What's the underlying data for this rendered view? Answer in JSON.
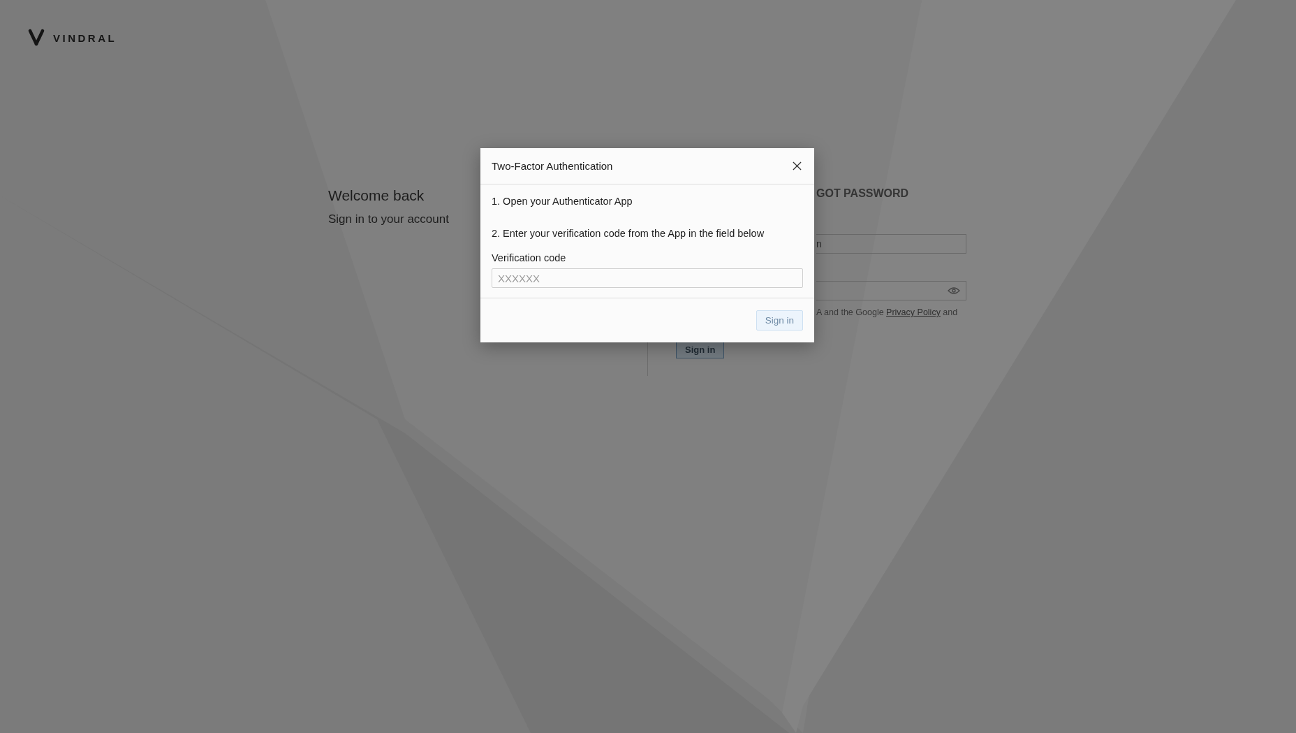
{
  "logo": {
    "wordmark": "VINDRAL"
  },
  "welcome": {
    "title": "Welcome back",
    "subtitle": "Sign in to your account"
  },
  "login_form": {
    "tab_fragment": "GOT PASSWORD",
    "username_fragment": "n",
    "legal": {
      "before": "A and the Google",
      "link": "Privacy Policy",
      "after": "and"
    },
    "submit": {
      "label": "Sign in"
    }
  },
  "dialog": {
    "title": "Two-Factor Authentication",
    "steps": [
      "1. Open your Authenticator App",
      "2. Enter your verification code from the App in the field below"
    ],
    "field": {
      "label": "Verification code",
      "placeholder": "XXXXXX"
    },
    "submit": {
      "label": "Sign in",
      "disabled": true
    }
  }
}
